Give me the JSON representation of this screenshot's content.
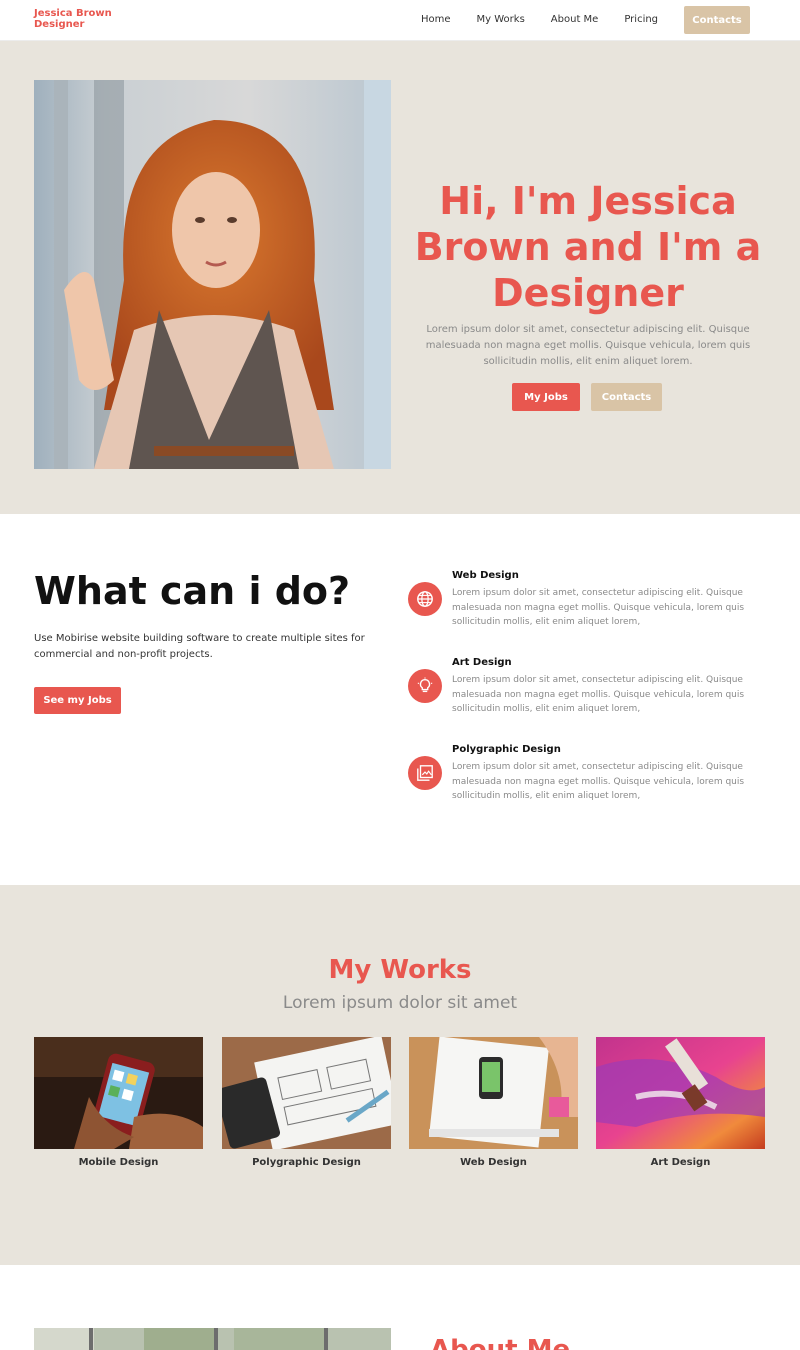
{
  "nav": {
    "brand_line1": "Jessica Brown",
    "brand_line2": "Designer",
    "links": [
      "Home",
      "My Works",
      "About Me",
      "Pricing"
    ],
    "cta": "Contacts"
  },
  "hero": {
    "title": "Hi, I'm Jessica Brown and I'm a Designer",
    "text": "Lorem ipsum dolor sit amet, consectetur adipiscing elit. Quisque malesuada non magna eget mollis. Quisque vehicula, lorem quis sollicitudin mollis, elit enim aliquet lorem.",
    "primary_button": "My Jobs",
    "secondary_button": "Contacts"
  },
  "services": {
    "title": "What can i do?",
    "description": "Use Mobirise website building software to create multiple sites for commercial and non-profit projects.",
    "button": "See my Jobs",
    "items": [
      {
        "name": "Web Design",
        "icon": "globe-icon",
        "text": "Lorem ipsum dolor sit amet, consectetur adipiscing elit. Quisque malesuada non magna eget mollis. Quisque vehicula, lorem quis sollicitudin mollis, elit enim aliquet lorem,"
      },
      {
        "name": "Art Design",
        "icon": "lightbulb-icon",
        "text": "Lorem ipsum dolor sit amet, consectetur adipiscing elit. Quisque malesuada non magna eget mollis. Quisque vehicula, lorem quis sollicitudin mollis, elit enim aliquet lorem,"
      },
      {
        "name": "Polygraphic Design",
        "icon": "image-gallery-icon",
        "text": "Lorem ipsum dolor sit amet, consectetur adipiscing elit. Quisque malesuada non magna eget mollis. Quisque vehicula, lorem quis sollicitudin mollis, elit enim aliquet lorem,"
      }
    ]
  },
  "works": {
    "title": "My Works",
    "subtitle": "Lorem ipsum dolor sit amet",
    "items": [
      {
        "label": "Mobile Design"
      },
      {
        "label": "Polygraphic Design"
      },
      {
        "label": "Web Design"
      },
      {
        "label": "Art Design"
      }
    ]
  },
  "about": {
    "title": "About Me"
  },
  "colors": {
    "accent": "#e8574f",
    "tan": "#d9c4a6",
    "section_bg": "#e8e4dc"
  }
}
